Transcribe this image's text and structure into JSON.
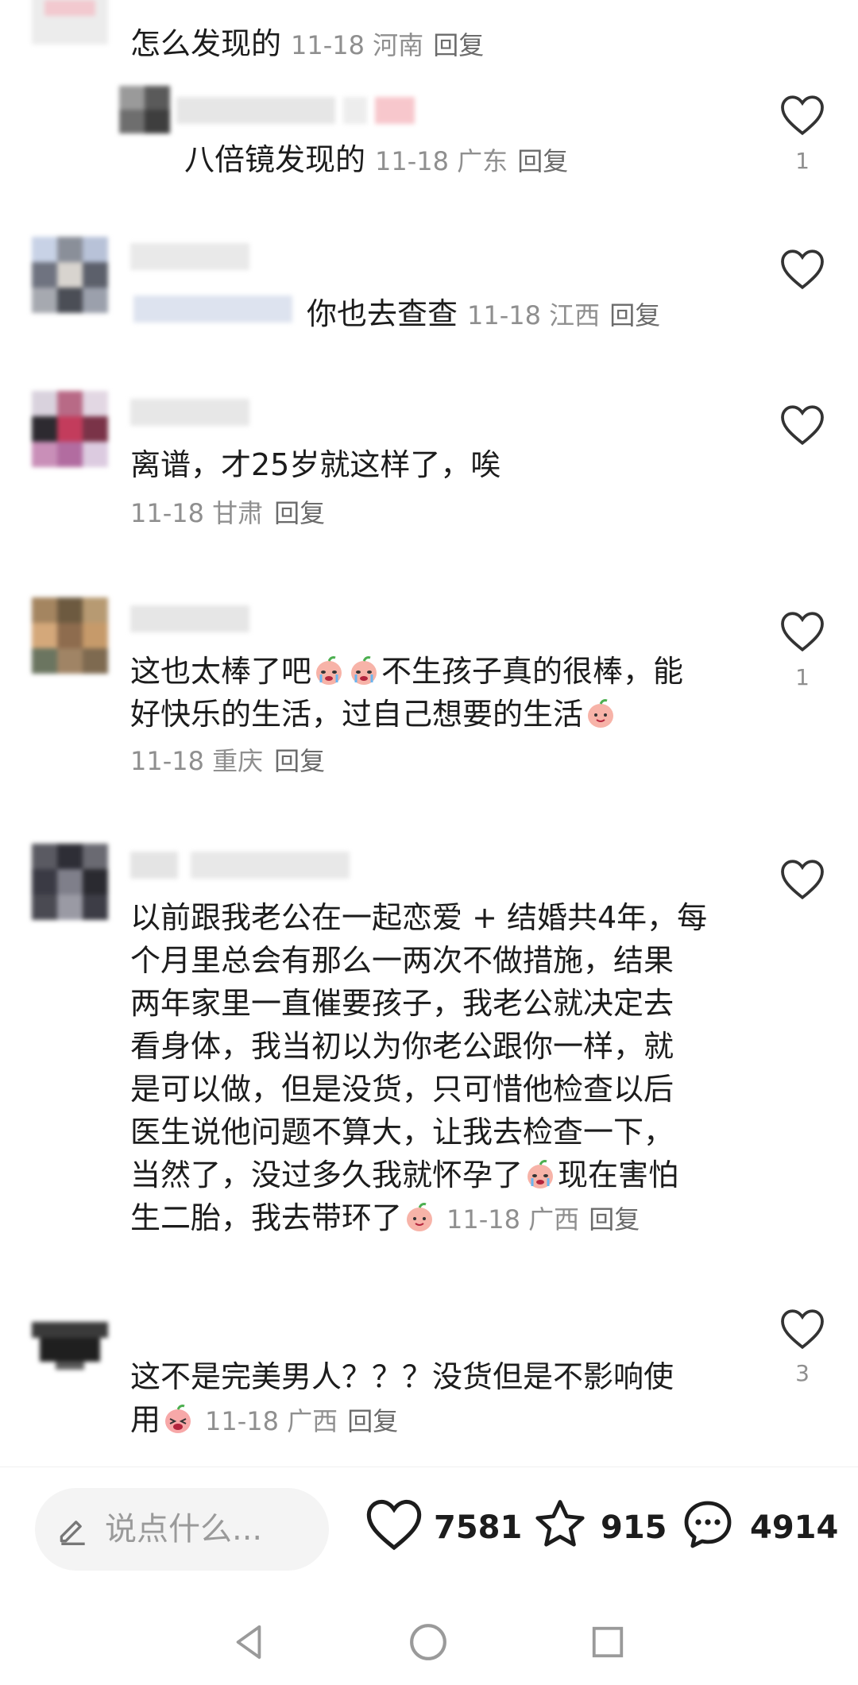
{
  "comments": [
    {
      "text": "怎么发现的",
      "date": "11-18",
      "region": "河南",
      "reply": "回复"
    },
    {
      "text": "八倍镜发现的",
      "date": "11-18",
      "region": "广东",
      "reply": "回复",
      "likes": "1"
    },
    {
      "text": "你也去查查",
      "date": "11-18",
      "region": "江西",
      "reply": "回复"
    },
    {
      "text": "离谱，才25岁就这样了，唉",
      "date": "11-18",
      "region": "甘肃",
      "reply": "回复"
    },
    {
      "lines": [
        "这也太棒了吧",
        "不生孩子真的很棒，能",
        "好快乐的生活，过自己想要的生活"
      ],
      "date": "11-18",
      "region": "重庆",
      "reply": "回复",
      "likes": "1"
    },
    {
      "lines": [
        "以前跟我老公在一起恋爱 + 结婚共4年，每",
        "个月里总会有那么一两次不做措施，结果",
        "两年家里一直催要孩子，我老公就决定去",
        "看身体，我当初以为你老公跟你一样，就",
        "是可以做，但是没货，只可惜他检查以后",
        "医生说他问题不算大，让我去检查一下，",
        "当然了，没过多久我就怀孕了",
        "现在害怕",
        "生二胎，我去带环了"
      ],
      "date": "11-18",
      "region": "广西",
      "reply": "回复"
    },
    {
      "lines": [
        "这不是完美男人？？？没货但是不影响使",
        "用"
      ],
      "date": "11-18",
      "region": "广西",
      "reply": "回复",
      "likes": "3"
    }
  ],
  "bottom_bar": {
    "input_placeholder": "说点什么...",
    "likes": "7581",
    "favorites": "915",
    "comments": "4914"
  },
  "icons": {
    "like": "heart-outline-icon",
    "favorite": "star-outline-icon",
    "comment": "chat-bubble-icon",
    "edit": "pen-icon",
    "emoji_cry": "crying-peach-emoji",
    "emoji_smile": "smiling-peach-emoji"
  },
  "colors": {
    "meta": "#8f8f8f",
    "text": "#1c1c1c",
    "icon": "#333333"
  }
}
